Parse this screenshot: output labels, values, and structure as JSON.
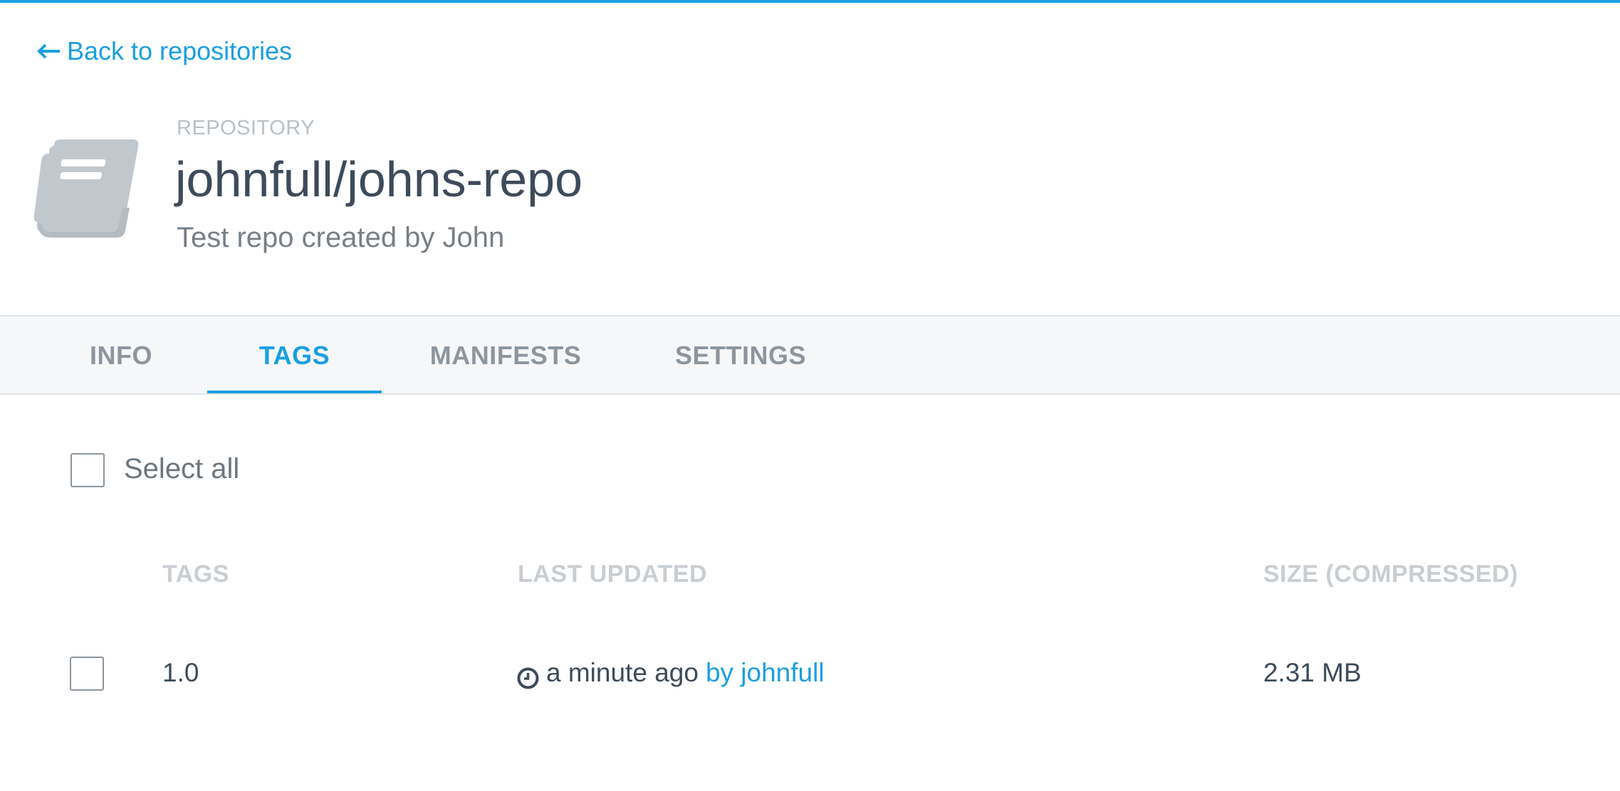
{
  "back_link": {
    "label": "Back to repositories",
    "icon": "arrow-left-icon"
  },
  "repository": {
    "kicker": "REPOSITORY",
    "name": "johnfull/johns-repo",
    "description": "Test repo created by John",
    "icon": "book-icon"
  },
  "tabs": [
    {
      "label": "INFO",
      "active": false
    },
    {
      "label": "TAGS",
      "active": true
    },
    {
      "label": "MANIFESTS",
      "active": false
    },
    {
      "label": "SETTINGS",
      "active": false
    }
  ],
  "tags_panel": {
    "select_all_label": "Select all",
    "columns": [
      "TAGS",
      "LAST UPDATED",
      "SIZE (COMPRESSED)"
    ],
    "rows": [
      {
        "tag": "1.0",
        "updated": "a minute ago",
        "updated_by": "by johnfull",
        "size": "2.31 MB",
        "checked": false
      }
    ]
  },
  "colors": {
    "accent": "#1a9fe0",
    "title": "#3d4b5a",
    "muted": "#8d969e",
    "tabbar_bg": "#f5f7f8"
  }
}
